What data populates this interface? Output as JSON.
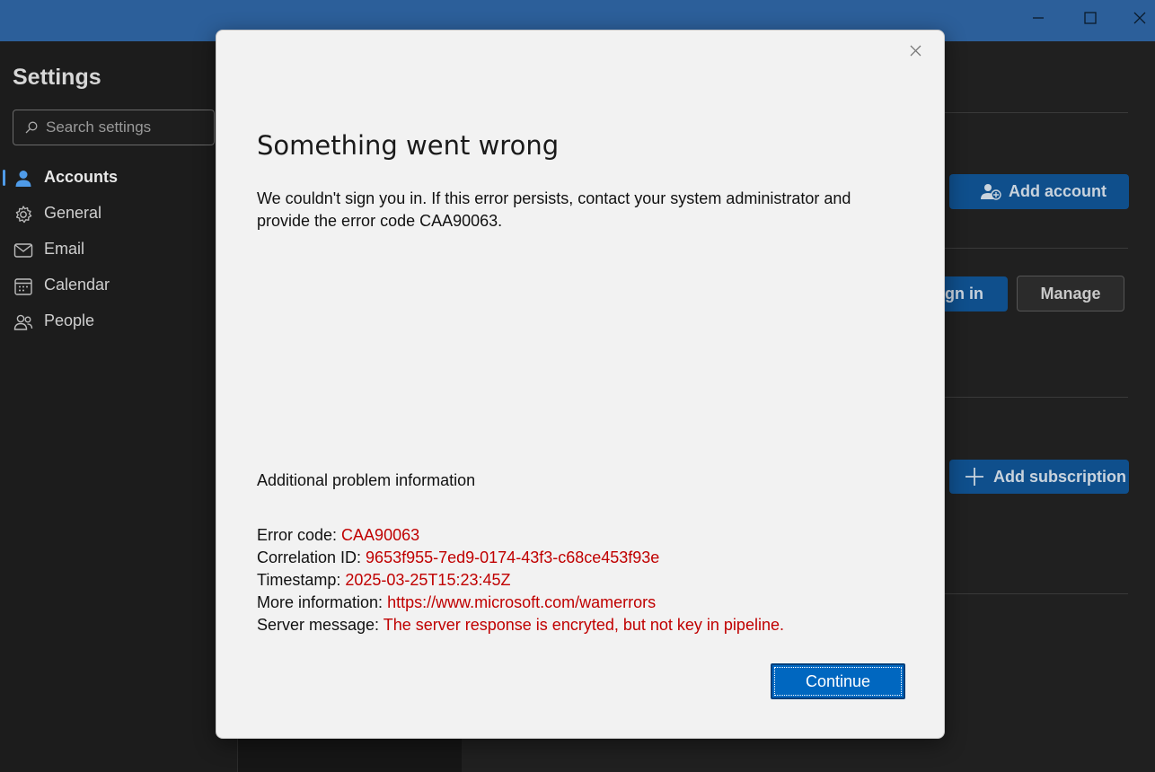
{
  "window": {
    "min_icon": "minimize-icon",
    "max_icon": "maximize-icon",
    "close_icon": "close-icon",
    "titlebar_color": "#2c5f9a"
  },
  "settings": {
    "title": "Settings",
    "search_placeholder": "Search settings",
    "nav": [
      {
        "label": "Accounts",
        "icon": "person-icon",
        "active": true
      },
      {
        "label": "General",
        "icon": "gear-icon"
      },
      {
        "label": "Email",
        "icon": "mail-icon"
      },
      {
        "label": "Calendar",
        "icon": "calendar-icon"
      },
      {
        "label": "People",
        "icon": "people-icon"
      }
    ]
  },
  "background_pane": {
    "add_account_label": "Add account",
    "sign_in_label": "gn in",
    "manage_label": "Manage",
    "add_subscription_label": "Add subscription"
  },
  "dialog": {
    "title": "Something went wrong",
    "body": "We couldn't sign you in. If this error persists, contact your system administrator and provide the error code CAA90063.",
    "subhead": "Additional problem information",
    "info": [
      {
        "label": "Error code: ",
        "value": "CAA90063"
      },
      {
        "label": "Correlation ID: ",
        "value": "9653f955-7ed9-0174-43f3-c68ce453f93e"
      },
      {
        "label": "Timestamp: ",
        "value": "2025-03-25T15:23:45Z"
      },
      {
        "label": "More information: ",
        "value": "https://www.microsoft.com/wamerrors"
      },
      {
        "label": "Server message: ",
        "value": "The server response is encryted, but not key in pipeline."
      }
    ],
    "continue_label": "Continue",
    "accent_color": "#0067c0",
    "error_color": "#c00000"
  }
}
